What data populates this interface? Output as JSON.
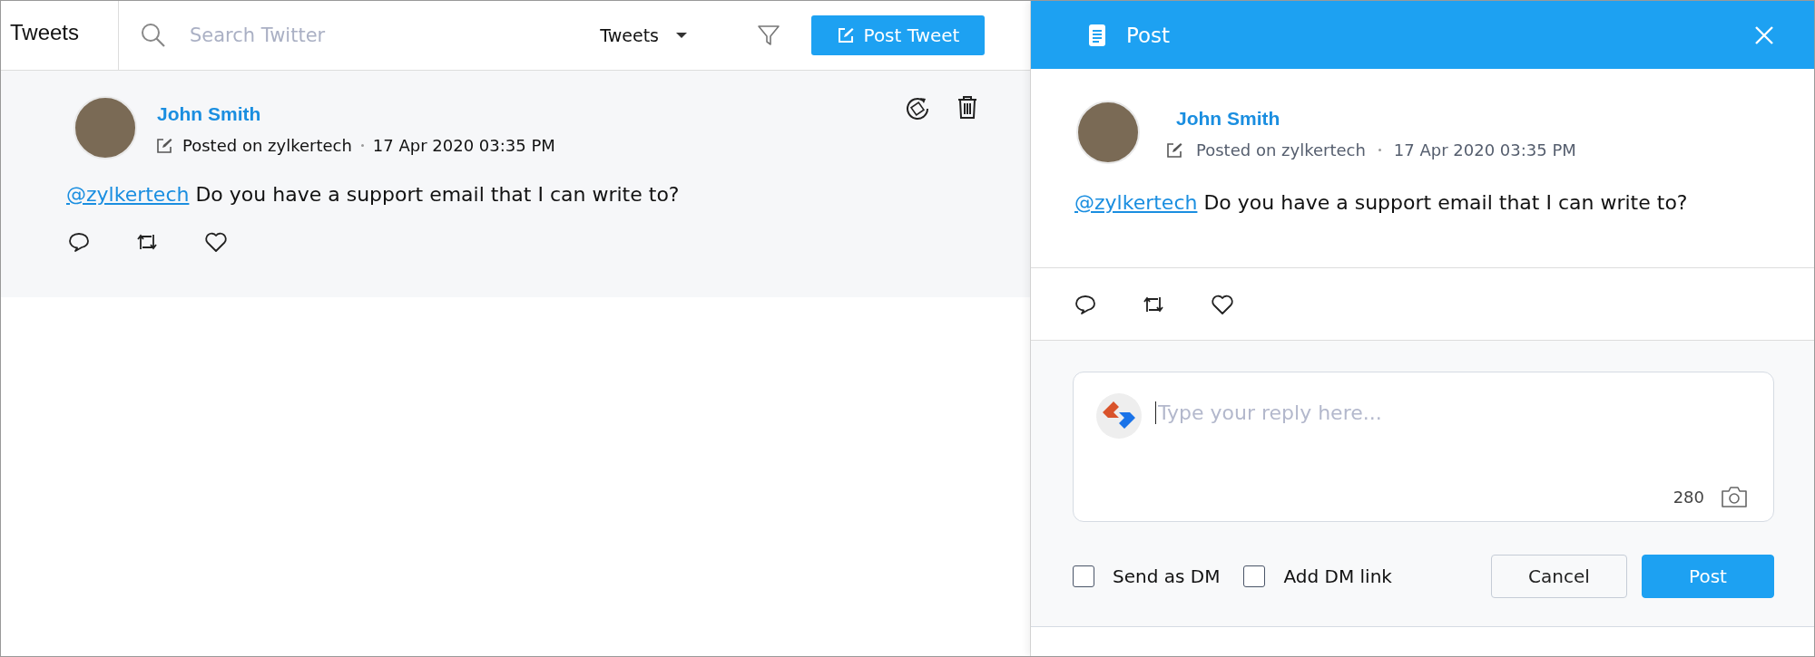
{
  "left": {
    "title": "Tweets",
    "search": {
      "placeholder": "Search Twitter"
    },
    "filter_dropdown": "Tweets",
    "post_button": "Post Tweet",
    "tweet": {
      "author": "John Smith",
      "posted_on": "Posted on zylkertech",
      "time": "17 Apr 2020 03:35 PM",
      "mention": "@zylkertech",
      "text": "Do you have a support email that I can write to?"
    }
  },
  "panel": {
    "title": "Post",
    "tweet": {
      "author": "John Smith",
      "posted_on": "Posted on zylkertech",
      "time": "17 Apr 2020 03:35 PM",
      "mention": "@zylkertech",
      "text": "Do you have a support email that I can write to?"
    },
    "reply": {
      "placeholder": "Type your reply here...",
      "count": "280"
    },
    "options": [
      {
        "label": "Send as DM",
        "checked": false
      },
      {
        "label": "Add DM link",
        "checked": false
      }
    ],
    "buttons": [
      {
        "label": "Cancel",
        "kind": "secondary"
      },
      {
        "label": "Post",
        "kind": "primary"
      }
    ]
  }
}
